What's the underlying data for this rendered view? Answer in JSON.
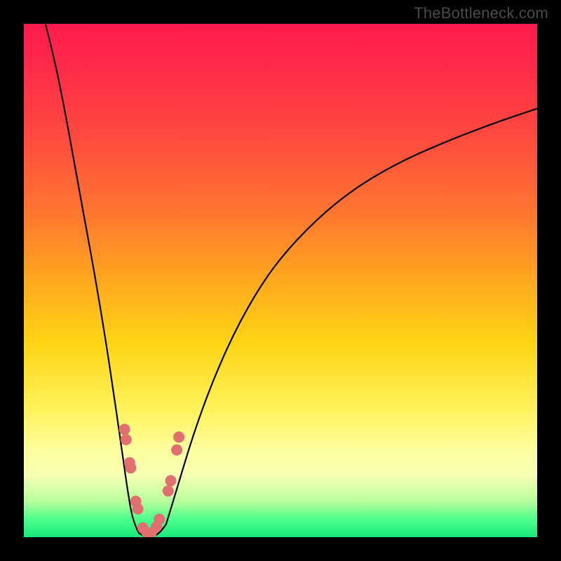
{
  "watermark": "TheBottleneck.com",
  "chart_data": {
    "type": "line",
    "title": "",
    "xlabel": "",
    "ylabel": "",
    "xlim": [
      0,
      1
    ],
    "ylim": [
      0,
      1
    ],
    "series": [
      {
        "name": "left-branch",
        "x": [
          0.042,
          0.06,
          0.08,
          0.1,
          0.12,
          0.14,
          0.16,
          0.175,
          0.188,
          0.198,
          0.204,
          0.21,
          0.218,
          0.224
        ],
        "y": [
          1.0,
          0.93,
          0.83,
          0.72,
          0.61,
          0.5,
          0.38,
          0.28,
          0.19,
          0.12,
          0.08,
          0.045,
          0.02,
          0.008
        ]
      },
      {
        "name": "valley",
        "x": [
          0.224,
          0.232,
          0.24,
          0.248,
          0.256,
          0.266,
          0.277
        ],
        "y": [
          0.008,
          0.003,
          0.001,
          0.001,
          0.003,
          0.01,
          0.025
        ]
      },
      {
        "name": "right-branch",
        "x": [
          0.277,
          0.3,
          0.33,
          0.37,
          0.42,
          0.48,
          0.55,
          0.63,
          0.72,
          0.82,
          0.92,
          1.0
        ],
        "y": [
          0.025,
          0.1,
          0.2,
          0.31,
          0.42,
          0.52,
          0.6,
          0.67,
          0.725,
          0.77,
          0.808,
          0.835
        ]
      }
    ],
    "markers": {
      "name": "highlighted-points",
      "x": [
        0.196,
        0.199,
        0.206,
        0.208,
        0.218,
        0.222,
        0.232,
        0.24,
        0.248,
        0.258,
        0.264,
        0.281,
        0.286,
        0.298,
        0.302
      ],
      "y": [
        0.21,
        0.19,
        0.145,
        0.135,
        0.07,
        0.055,
        0.018,
        0.008,
        0.008,
        0.02,
        0.035,
        0.09,
        0.11,
        0.17,
        0.195
      ]
    },
    "background_gradient": {
      "top_color": "#ff1a4d",
      "mid_color": "#fff25a",
      "bottom_color": "#18e87a"
    }
  }
}
